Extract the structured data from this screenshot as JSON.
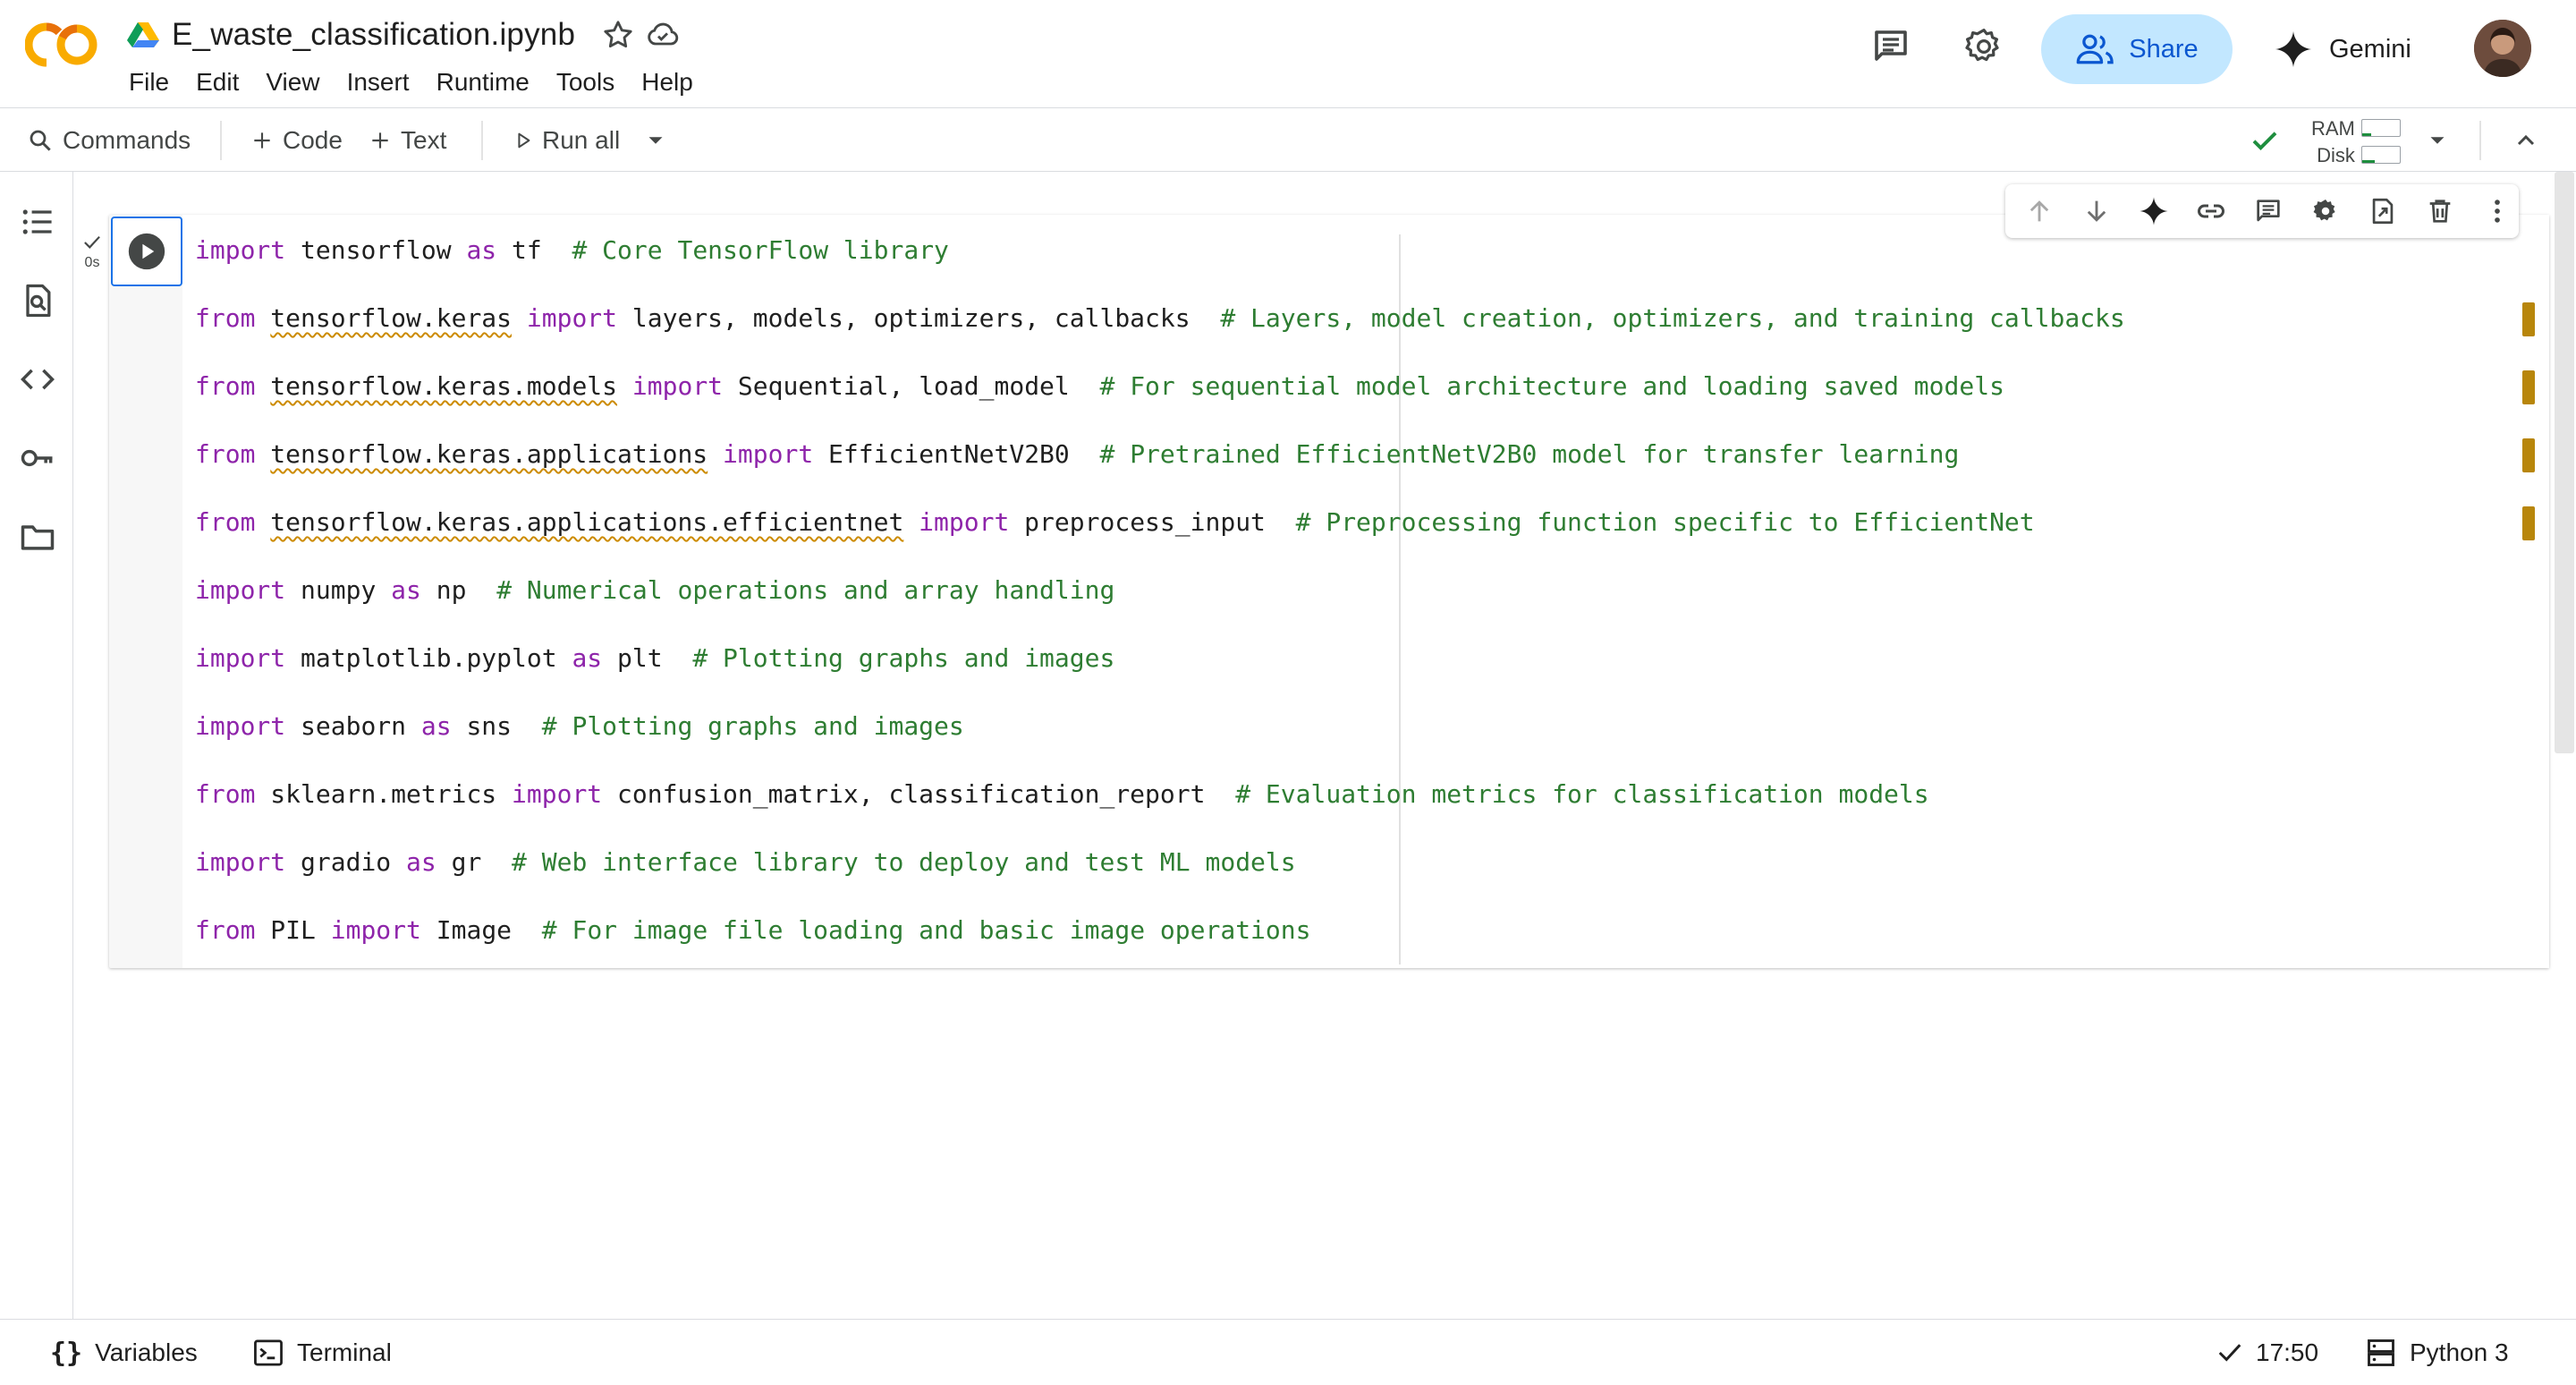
{
  "header": {
    "file_title": "E_waste_classification.ipynb",
    "menu": [
      "File",
      "Edit",
      "View",
      "Insert",
      "Runtime",
      "Tools",
      "Help"
    ],
    "share_label": "Share",
    "gemini_label": "Gemini"
  },
  "toolbar": {
    "commands_label": "Commands",
    "code_label": "Code",
    "text_label": "Text",
    "run_all_label": "Run all",
    "ram_label": "RAM",
    "disk_label": "Disk"
  },
  "cell": {
    "exec_time": "0s",
    "lines": [
      [
        {
          "t": "import",
          "c": "kw"
        },
        {
          "t": " tensorflow "
        },
        {
          "t": "as",
          "c": "kw"
        },
        {
          "t": " tf  "
        },
        {
          "t": "# Core TensorFlow library",
          "c": "cm"
        }
      ],
      [
        {
          "t": "from",
          "c": "kw"
        },
        {
          "t": " "
        },
        {
          "t": "tensorflow.keras",
          "c": "sq"
        },
        {
          "t": " "
        },
        {
          "t": "import",
          "c": "kw"
        },
        {
          "t": " layers, models, optimizers, callbacks  "
        },
        {
          "t": "# Layers, model creation, optimizers, and training callbacks",
          "c": "cm"
        }
      ],
      [
        {
          "t": "from",
          "c": "kw"
        },
        {
          "t": " "
        },
        {
          "t": "tensorflow.keras.models",
          "c": "sq"
        },
        {
          "t": " "
        },
        {
          "t": "import",
          "c": "kw"
        },
        {
          "t": " Sequential, load_model  "
        },
        {
          "t": "# For sequential model architecture and loading saved models",
          "c": "cm"
        }
      ],
      [
        {
          "t": "from",
          "c": "kw"
        },
        {
          "t": " "
        },
        {
          "t": "tensorflow.keras.applications",
          "c": "sq"
        },
        {
          "t": " "
        },
        {
          "t": "import",
          "c": "kw"
        },
        {
          "t": " EfficientNetV2B0  "
        },
        {
          "t": "# Pretrained EfficientNetV2B0 model for transfer learning",
          "c": "cm"
        }
      ],
      [
        {
          "t": "from",
          "c": "kw"
        },
        {
          "t": " "
        },
        {
          "t": "tensorflow.keras.applications.efficientnet",
          "c": "sq"
        },
        {
          "t": " "
        },
        {
          "t": "import",
          "c": "kw"
        },
        {
          "t": " preprocess_input  "
        },
        {
          "t": "# Preprocessing function specific to EfficientNet",
          "c": "cm"
        }
      ],
      [
        {
          "t": "import",
          "c": "kw"
        },
        {
          "t": " numpy "
        },
        {
          "t": "as",
          "c": "kw"
        },
        {
          "t": " np  "
        },
        {
          "t": "# Numerical operations and array handling",
          "c": "cm"
        }
      ],
      [
        {
          "t": "import",
          "c": "kw"
        },
        {
          "t": " matplotlib.pyplot "
        },
        {
          "t": "as",
          "c": "kw"
        },
        {
          "t": " plt  "
        },
        {
          "t": "# Plotting graphs and images",
          "c": "cm"
        }
      ],
      [
        {
          "t": "import",
          "c": "kw"
        },
        {
          "t": " seaborn "
        },
        {
          "t": "as",
          "c": "kw"
        },
        {
          "t": " sns  "
        },
        {
          "t": "# Plotting graphs and images",
          "c": "cm"
        }
      ],
      [
        {
          "t": "from",
          "c": "kw"
        },
        {
          "t": " sklearn.metrics "
        },
        {
          "t": "import",
          "c": "kw"
        },
        {
          "t": " confusion_matrix, classification_report  "
        },
        {
          "t": "# Evaluation metrics for classification models",
          "c": "cm"
        }
      ],
      [
        {
          "t": "import",
          "c": "kw"
        },
        {
          "t": " gradio "
        },
        {
          "t": "as",
          "c": "kw"
        },
        {
          "t": " gr  "
        },
        {
          "t": "# Web interface library to deploy and test ML models",
          "c": "cm"
        }
      ],
      [
        {
          "t": "from",
          "c": "kw"
        },
        {
          "t": " PIL "
        },
        {
          "t": "import",
          "c": "kw"
        },
        {
          "t": " Image  "
        },
        {
          "t": "# For image file loading and basic image operations",
          "c": "cm"
        }
      ]
    ]
  },
  "statusbar": {
    "variables_label": "Variables",
    "terminal_label": "Terminal",
    "time": "17:50",
    "runtime_label": "Python 3"
  },
  "colors": {
    "keyword": "#8e24aa",
    "comment": "#2e7d32",
    "share_bg": "#c2e7ff",
    "accent": "#1a73e8"
  }
}
